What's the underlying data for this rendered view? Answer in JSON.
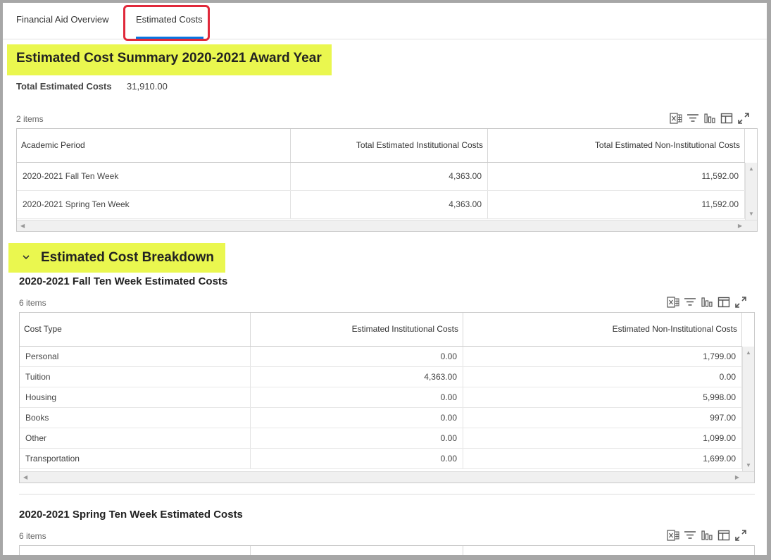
{
  "tabs": {
    "overview": "Financial Aid Overview",
    "costs": "Estimated Costs"
  },
  "summary": {
    "title": "Estimated Cost Summary 2020-2021 Award Year",
    "total_label": "Total Estimated Costs",
    "total_value": "31,910.00",
    "items_count": "2 items",
    "columns": [
      "Academic Period",
      "Total Estimated Institutional Costs",
      "Total Estimated Non-Institutional Costs"
    ],
    "rows": [
      [
        "2020-2021 Fall Ten Week",
        "4,363.00",
        "11,592.00"
      ],
      [
        "2020-2021 Spring Ten Week",
        "4,363.00",
        "11,592.00"
      ]
    ]
  },
  "breakdown": {
    "title": "Estimated Cost Breakdown",
    "fall": {
      "title": "2020-2021 Fall Ten Week Estimated Costs",
      "items_count": "6 items",
      "columns": [
        "Cost Type",
        "Estimated Institutional Costs",
        "Estimated Non-Institutional Costs"
      ],
      "rows": [
        [
          "Personal",
          "0.00",
          "1,799.00"
        ],
        [
          "Tuition",
          "4,363.00",
          "0.00"
        ],
        [
          "Housing",
          "0.00",
          "5,998.00"
        ],
        [
          "Books",
          "0.00",
          "997.00"
        ],
        [
          "Other",
          "0.00",
          "1,099.00"
        ],
        [
          "Transportation",
          "0.00",
          "1,699.00"
        ]
      ]
    },
    "spring": {
      "title": "2020-2021 Spring Ten Week Estimated Costs",
      "items_count": "6 items"
    }
  },
  "icons": [
    "export-excel-icon",
    "filter-icon",
    "chart-icon",
    "column-layout-icon",
    "fullscreen-icon",
    "collapse-chevron-icon"
  ],
  "colors": {
    "highlight": "#eaf74f",
    "tab_underline": "#0875e1",
    "tab_annotation": "#e0283a"
  }
}
